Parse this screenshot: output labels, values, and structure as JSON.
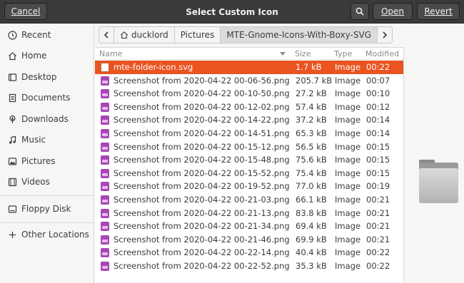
{
  "header": {
    "title": "Select Custom Icon",
    "cancel_label": "Cancel",
    "open_label": "Open",
    "revert_label": "Revert",
    "search_icon": "search-icon"
  },
  "sidebar": {
    "items": [
      {
        "label": "Recent",
        "icon": "clock-icon"
      },
      {
        "label": "Home",
        "icon": "home-icon"
      },
      {
        "label": "Desktop",
        "icon": "desktop-icon"
      },
      {
        "label": "Documents",
        "icon": "document-icon"
      },
      {
        "label": "Downloads",
        "icon": "download-icon"
      },
      {
        "label": "Music",
        "icon": "music-icon"
      },
      {
        "label": "Pictures",
        "icon": "picture-icon"
      },
      {
        "label": "Videos",
        "icon": "video-icon"
      },
      {
        "label": "Floppy Disk",
        "icon": "drive-icon"
      },
      {
        "label": "Other Locations",
        "icon": "plus-icon"
      }
    ]
  },
  "pathbar": {
    "segments": [
      "ducklord",
      "Pictures",
      "MTE-Gnome-Icons-With-Boxy-SVG"
    ],
    "active_index": 2
  },
  "file_list": {
    "columns": {
      "name": "Name",
      "size": "Size",
      "type": "Type",
      "modified": "Modified"
    },
    "sort_column": "Name",
    "rows": [
      {
        "name": "mte-folder-icon.svg",
        "size": "1.7 kB",
        "type": "Image",
        "modified": "00:22",
        "icon": "svg-file-icon",
        "selected": true
      },
      {
        "name": "Screenshot from 2020-04-22 00-06-56.png",
        "size": "205.7 kB",
        "type": "Image",
        "modified": "00:07",
        "icon": "image-file-icon",
        "selected": false
      },
      {
        "name": "Screenshot from 2020-04-22 00-10-50.png",
        "size": "27.2 kB",
        "type": "Image",
        "modified": "00:10",
        "icon": "image-file-icon",
        "selected": false
      },
      {
        "name": "Screenshot from 2020-04-22 00-12-02.png",
        "size": "57.4 kB",
        "type": "Image",
        "modified": "00:12",
        "icon": "image-file-icon",
        "selected": false
      },
      {
        "name": "Screenshot from 2020-04-22 00-14-22.png",
        "size": "37.2 kB",
        "type": "Image",
        "modified": "00:14",
        "icon": "image-file-icon",
        "selected": false
      },
      {
        "name": "Screenshot from 2020-04-22 00-14-51.png",
        "size": "65.3 kB",
        "type": "Image",
        "modified": "00:14",
        "icon": "image-file-icon",
        "selected": false
      },
      {
        "name": "Screenshot from 2020-04-22 00-15-12.png",
        "size": "56.5 kB",
        "type": "Image",
        "modified": "00:15",
        "icon": "image-file-icon",
        "selected": false
      },
      {
        "name": "Screenshot from 2020-04-22 00-15-48.png",
        "size": "75.6 kB",
        "type": "Image",
        "modified": "00:15",
        "icon": "image-file-icon",
        "selected": false
      },
      {
        "name": "Screenshot from 2020-04-22 00-15-52.png",
        "size": "75.4 kB",
        "type": "Image",
        "modified": "00:15",
        "icon": "image-file-icon",
        "selected": false
      },
      {
        "name": "Screenshot from 2020-04-22 00-19-52.png",
        "size": "77.0 kB",
        "type": "Image",
        "modified": "00:19",
        "icon": "image-file-icon",
        "selected": false
      },
      {
        "name": "Screenshot from 2020-04-22 00-21-03.png",
        "size": "66.1 kB",
        "type": "Image",
        "modified": "00:21",
        "icon": "image-file-icon",
        "selected": false
      },
      {
        "name": "Screenshot from 2020-04-22 00-21-13.png",
        "size": "83.8 kB",
        "type": "Image",
        "modified": "00:21",
        "icon": "image-file-icon",
        "selected": false
      },
      {
        "name": "Screenshot from 2020-04-22 00-21-34.png",
        "size": "69.4 kB",
        "type": "Image",
        "modified": "00:21",
        "icon": "image-file-icon",
        "selected": false
      },
      {
        "name": "Screenshot from 2020-04-22 00-21-46.png",
        "size": "69.9 kB",
        "type": "Image",
        "modified": "00:21",
        "icon": "image-file-icon",
        "selected": false
      },
      {
        "name": "Screenshot from 2020-04-22 00-22-14.png",
        "size": "40.4 kB",
        "type": "Image",
        "modified": "00:22",
        "icon": "image-file-icon",
        "selected": false
      },
      {
        "name": "Screenshot from 2020-04-22 00-22-52.png",
        "size": "35.3 kB",
        "type": "Image",
        "modified": "00:22",
        "icon": "image-file-icon",
        "selected": false
      }
    ]
  },
  "preview": {
    "icon": "folder-icon"
  },
  "colors": {
    "accent": "#e95420",
    "header_bg": "#3a3a3a",
    "image_icon": "#a846b5"
  }
}
